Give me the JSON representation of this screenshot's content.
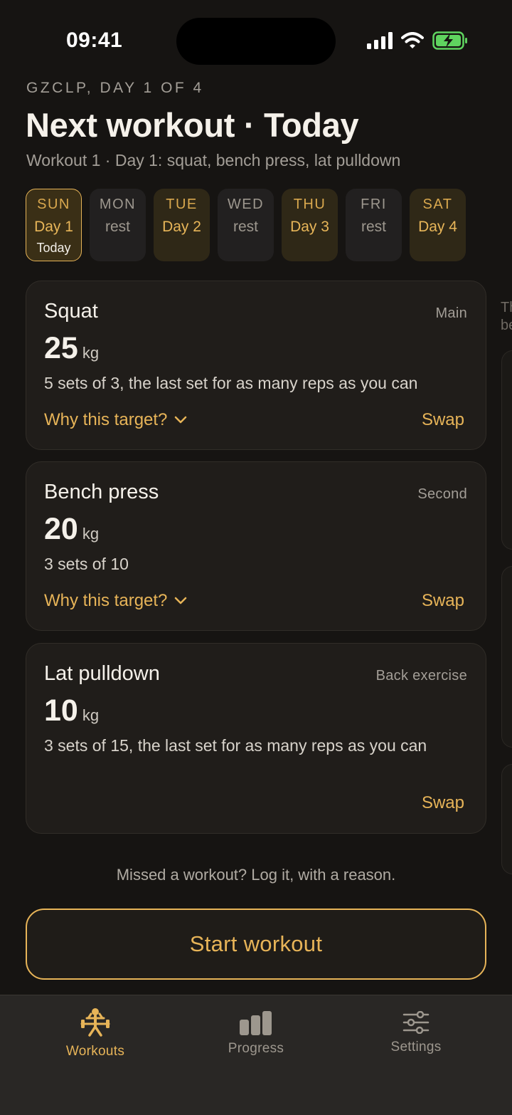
{
  "status": {
    "time": "09:41"
  },
  "header": {
    "kicker": "GZCLP, DAY 1 OF 4",
    "title": "Next workout · Today",
    "subtitle": "Workout 1 · Day 1: squat, bench press, lat pulldown"
  },
  "days": [
    {
      "name": "SUN",
      "label": "Day 1",
      "tag": "Today",
      "kind": "active"
    },
    {
      "name": "MON",
      "label": "rest",
      "kind": "rest"
    },
    {
      "name": "TUE",
      "label": "Day 2",
      "kind": "train"
    },
    {
      "name": "WED",
      "label": "rest",
      "kind": "rest"
    },
    {
      "name": "THU",
      "label": "Day 3",
      "kind": "train"
    },
    {
      "name": "FRI",
      "label": "rest",
      "kind": "rest"
    },
    {
      "name": "SAT",
      "label": "Day 4",
      "kind": "train"
    }
  ],
  "exercises": [
    {
      "name": "Squat",
      "role": "Main",
      "weight": "25",
      "unit": "kg",
      "scheme": "5 sets of 3, the last set for as many reps as you can",
      "why": "Why this target?",
      "swap": "Swap"
    },
    {
      "name": "Bench press",
      "role": "Second",
      "weight": "20",
      "unit": "kg",
      "scheme": "3 sets of 10",
      "why": "Why this target?",
      "swap": "Swap"
    },
    {
      "name": "Lat pulldown",
      "role": "Back exercise",
      "weight": "10",
      "unit": "kg",
      "scheme": "3 sets of 15, the last set for as many reps as you can",
      "swap": "Swap"
    }
  ],
  "peek": {
    "line1": "Th",
    "line2": "be"
  },
  "missed_text": "Missed a workout? Log it, with a reason.",
  "start_label": "Start workout",
  "tabs": [
    {
      "label": "Workouts",
      "icon": "barbell-lifter-icon",
      "active": true
    },
    {
      "label": "Progress",
      "icon": "bar-chart-icon",
      "active": false
    },
    {
      "label": "Settings",
      "icon": "sliders-icon",
      "active": false
    }
  ],
  "colors": {
    "accent": "#e7b458",
    "background": "#161412",
    "card": "#201d1a",
    "battery": "#5fd35f"
  }
}
